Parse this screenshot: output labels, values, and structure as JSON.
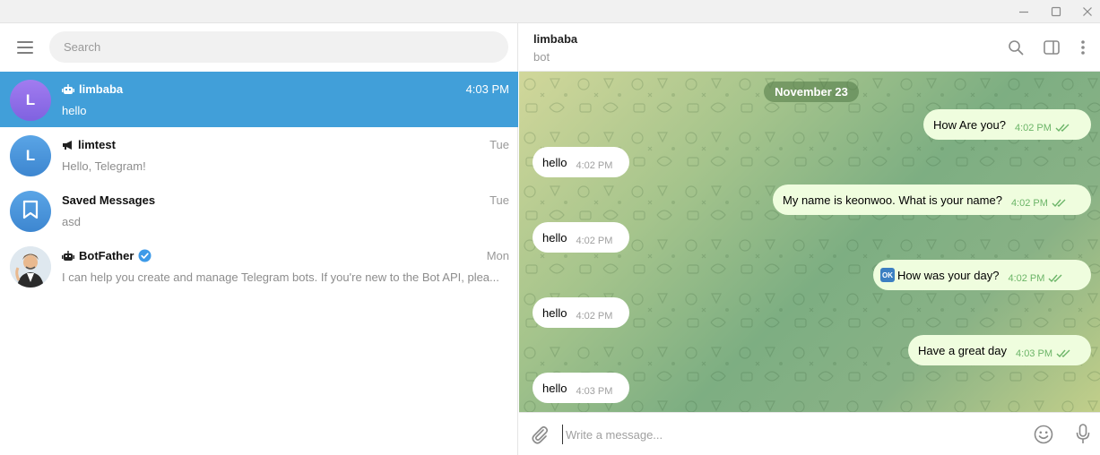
{
  "window": {
    "controls": [
      "minimize-icon",
      "maximize-icon",
      "close-icon"
    ]
  },
  "sidebar": {
    "search_placeholder": "Search",
    "chats": [
      {
        "initial": "L",
        "name": "limbaba",
        "type_icon": "bot-icon",
        "time": "4:03 PM",
        "preview": "hello",
        "avatar_color": "#8f73e8",
        "active": true
      },
      {
        "initial": "L",
        "name": "limtest",
        "type_icon": "megaphone-icon",
        "time": "Tue",
        "preview": "Hello, Telegram!",
        "avatar_color": "#4a94dc",
        "active": false
      },
      {
        "initial": "",
        "name": "Saved Messages",
        "type_icon": "",
        "time": "Tue",
        "preview": "asd",
        "avatar_color": "#4a94dc",
        "active": false
      },
      {
        "initial": "",
        "name": "BotFather",
        "type_icon": "bot-icon",
        "time": "Mon",
        "preview": "I can help you create and manage Telegram bots. If you're new to the Bot API, plea...",
        "avatar_color": "#e8eef3",
        "active": false,
        "verified": true
      }
    ]
  },
  "chat": {
    "peer_name": "limbaba",
    "peer_status": "bot",
    "date_badge": "November 23",
    "messages": [
      {
        "direction": "out",
        "text": "How Are you?",
        "time": "4:02 PM"
      },
      {
        "direction": "in",
        "text": "hello",
        "time": "4:02 PM"
      },
      {
        "direction": "out",
        "text": "My name is keonwoo. What is your name?",
        "time": "4:02 PM"
      },
      {
        "direction": "in",
        "text": "hello",
        "time": "4:02 PM"
      },
      {
        "direction": "out",
        "emoji": "OK",
        "text": "How was your day?",
        "time": "4:02 PM"
      },
      {
        "direction": "in",
        "text": "hello",
        "time": "4:02 PM"
      },
      {
        "direction": "out",
        "text": "Have a great day",
        "time": "4:03 PM"
      },
      {
        "direction": "in",
        "text": "hello",
        "time": "4:03 PM"
      }
    ],
    "composer_placeholder": "Write a message..."
  },
  "colors": {
    "accent": "#419fd9",
    "out_bubble": "#effdde",
    "in_bubble": "#ffffff",
    "read_check": "#6cb568"
  }
}
